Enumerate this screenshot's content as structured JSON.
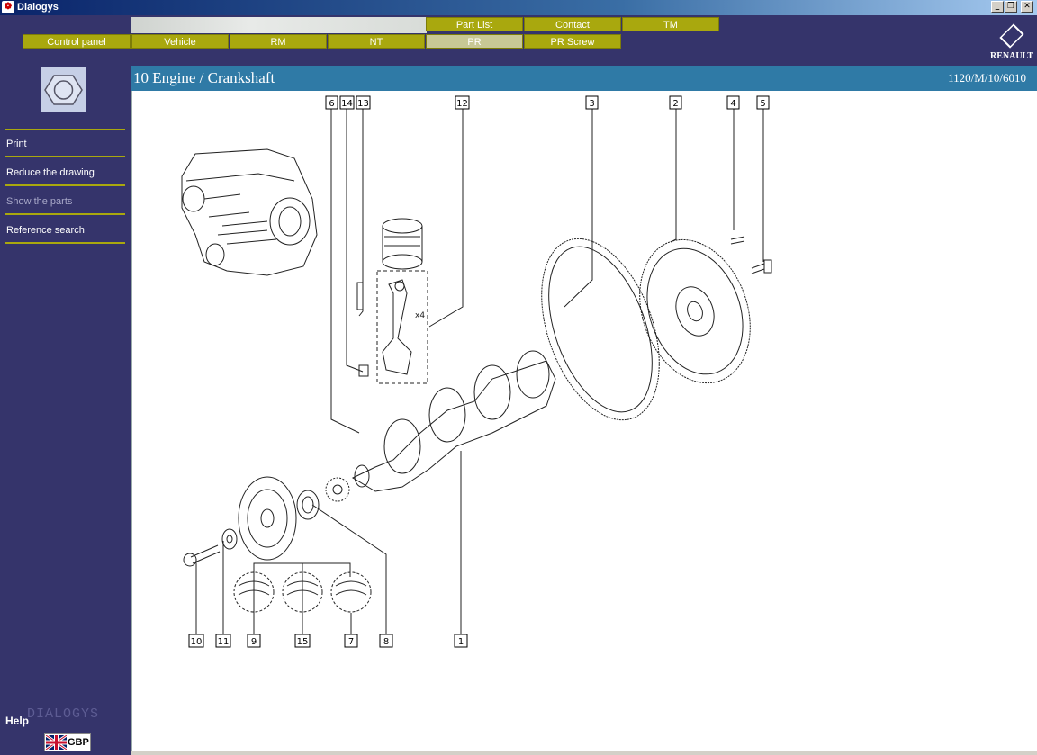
{
  "window": {
    "title": "Dialogys",
    "buttons": [
      "minimize",
      "restore",
      "close"
    ]
  },
  "nav": {
    "top_tabs": [
      "Part List",
      "Contact",
      "TM"
    ],
    "main_tabs": [
      "Control panel",
      "Vehicle",
      "RM",
      "NT",
      "PR",
      "PR Screw"
    ],
    "active_tab": "PR"
  },
  "brand": {
    "logo_text": "RENAULT"
  },
  "sidebar": {
    "links": [
      {
        "label": "Print",
        "enabled": true
      },
      {
        "label": "Reduce the drawing",
        "enabled": true
      },
      {
        "label": "Show the parts",
        "enabled": false
      },
      {
        "label": "Reference search",
        "enabled": true
      }
    ],
    "help_label": "Help",
    "app_mark": "DIALOGYS",
    "language_code": "GBP"
  },
  "page": {
    "title": "10 Engine / Crankshaft",
    "reference": "1120/M/10/6010"
  },
  "drawing": {
    "callouts_top": [
      "6",
      "14",
      "13",
      "12",
      "3",
      "2",
      "4",
      "5"
    ],
    "callouts_bottom": [
      "10",
      "11",
      "9",
      "15",
      "7",
      "8",
      "1"
    ],
    "piston_count_label": "x4"
  },
  "colors": {
    "accent": "#a9a80e",
    "background": "#35346b",
    "title_bar": "#2f7aa6",
    "active_tab": "#c8c895"
  }
}
